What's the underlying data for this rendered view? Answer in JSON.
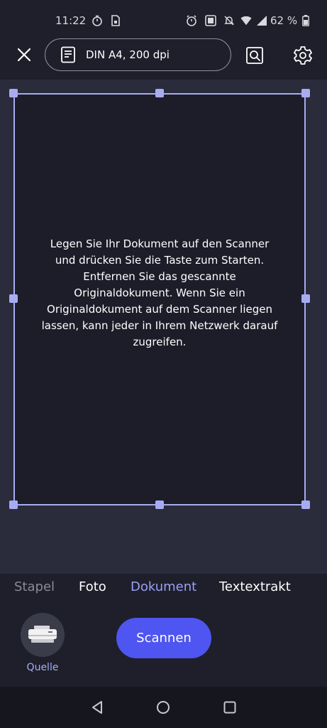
{
  "status_bar": {
    "time": "11:22",
    "battery_text": "62 %",
    "icons": [
      "timer-icon",
      "sim-icon",
      "alarm-icon",
      "nfc-icon",
      "mute-icon",
      "wifi-icon",
      "signal-icon",
      "battery-icon"
    ]
  },
  "top_bar": {
    "close_icon": "close-icon",
    "preset_icon": "document-icon",
    "preset_label": "DIN A4, 200 dpi",
    "preview_icon": "zoom-preview-icon",
    "settings_icon": "gear-icon"
  },
  "preview": {
    "instruction": "Legen Sie Ihr Dokument auf den Scanner und drücken Sie die Taste zum Starten. Entfernen Sie das gescannte Originaldokument. Wenn Sie ein Originaldokument auf dem Scanner liegen lassen, kann jeder in Ihrem Netzwerk darauf zugreifen."
  },
  "mode_tabs": [
    {
      "label": "Stapel",
      "active": false
    },
    {
      "label": "Foto",
      "active": false
    },
    {
      "label": "Dokument",
      "active": true
    },
    {
      "label": "Textextrakt",
      "active": false
    }
  ],
  "bottom_bar": {
    "source_label": "Quelle",
    "source_icon": "printer-icon",
    "scan_label": "Scannen"
  },
  "nav_bar": {
    "icons": [
      "back-icon",
      "home-icon",
      "recents-icon"
    ]
  },
  "colors": {
    "accent": "#4f55f0",
    "frame": "#a7acf2",
    "background": "#1e1f2a"
  }
}
